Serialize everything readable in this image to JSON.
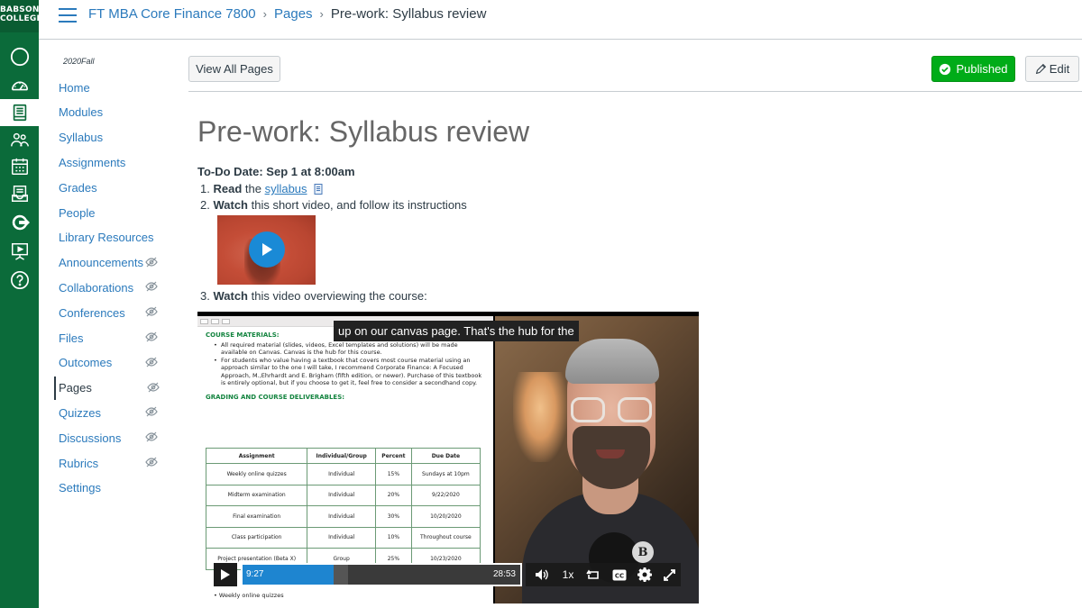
{
  "brand": {
    "line1": "BABSON",
    "line2": "COLLEGE"
  },
  "global_nav": [
    {
      "name": "account-icon",
      "icon": "circle"
    },
    {
      "name": "dashboard-icon",
      "icon": "speedometer"
    },
    {
      "name": "courses-icon",
      "icon": "book",
      "active": true
    },
    {
      "name": "groups-icon",
      "icon": "people"
    },
    {
      "name": "calendar-icon",
      "icon": "calendar"
    },
    {
      "name": "inbox-icon",
      "icon": "inbox"
    },
    {
      "name": "commons-icon",
      "icon": "arrow-share"
    },
    {
      "name": "studio-icon",
      "icon": "presentation"
    },
    {
      "name": "help-icon",
      "icon": "question"
    }
  ],
  "breadcrumb": {
    "course": "FT MBA Core Finance 7800",
    "section": "Pages",
    "current": "Pre-work: Syllabus review"
  },
  "course_nav": {
    "term": "2020Fall",
    "items": [
      {
        "label": "Home",
        "hidden": false
      },
      {
        "label": "Modules",
        "hidden": false
      },
      {
        "label": "Syllabus",
        "hidden": false
      },
      {
        "label": "Assignments",
        "hidden": false
      },
      {
        "label": "Grades",
        "hidden": false
      },
      {
        "label": "People",
        "hidden": false
      },
      {
        "label": "Library Resources",
        "hidden": false
      },
      {
        "label": "Announcements",
        "hidden": true
      },
      {
        "label": "Collaborations",
        "hidden": true
      },
      {
        "label": "Conferences",
        "hidden": true
      },
      {
        "label": "Files",
        "hidden": true
      },
      {
        "label": "Outcomes",
        "hidden": true
      },
      {
        "label": "Pages",
        "hidden": true,
        "active": true
      },
      {
        "label": "Quizzes",
        "hidden": true
      },
      {
        "label": "Discussions",
        "hidden": true
      },
      {
        "label": "Rubrics",
        "hidden": true
      },
      {
        "label": "Settings",
        "hidden": false
      }
    ]
  },
  "toolbar": {
    "view_all": "View All Pages",
    "published": "Published",
    "edit": "Edit"
  },
  "page": {
    "title": "Pre-work: Syllabus review",
    "todo": "To-Do Date: Sep 1 at 8:00am",
    "steps": [
      {
        "num": "1.",
        "bold": "Read",
        "pre": " the ",
        "link": "syllabus",
        "post": ""
      },
      {
        "num": "2.",
        "bold": "Watch",
        "pre": " this short video, and follow its instructions",
        "link": "",
        "post": ""
      },
      {
        "num": "3.",
        "bold": "Watch",
        "pre": " this video overviewing the course:",
        "link": "",
        "post": ""
      }
    ]
  },
  "video": {
    "caption": "up on our canvas page. That's the hub for the",
    "current_time": "9:27",
    "duration": "28:53",
    "speed": "1x",
    "played_fraction": 0.327,
    "buffered_fraction": 0.38,
    "doc": {
      "materials_heading": "COURSE MATERIALS:",
      "materials": [
        "All required material (slides, videos, Excel templates and solutions) will be made available on Canvas. Canvas is the hub for this course.",
        "For students who value having a textbook that covers most course material using an approach similar to the one I will take, I recommend Corporate Finance:  A Focused Approach, M.,Ehrhardt and E. Brigham (fifth edition, or newer). Purchase of this textbook is entirely optional, but if you choose to get it, feel free to consider a secondhand copy."
      ],
      "grading_heading": "GRADING AND COURSE DELIVERABLES:",
      "table_headers": [
        "Assignment",
        "Individual/Group",
        "Percent",
        "Due Date"
      ],
      "table_rows": [
        [
          "Weekly online quizzes",
          "Individual",
          "15%",
          "Sundays at 10pm"
        ],
        [
          "Midterm examination",
          "Individual",
          "20%",
          "9/22/2020"
        ],
        [
          "Final examination",
          "Individual",
          "30%",
          "10/20/2020"
        ],
        [
          "Class participation",
          "Individual",
          "10%",
          "Throughout course"
        ],
        [
          "Project presentation (Beta X)",
          "Group",
          "25%",
          "10/23/2020"
        ]
      ],
      "tail": "Weekly online quizzes"
    }
  },
  "colors": {
    "nav_green": "#0b6b3a",
    "link_blue": "#2b7abc",
    "published_green": "#00ac18",
    "progress_blue": "#1e85d0"
  }
}
